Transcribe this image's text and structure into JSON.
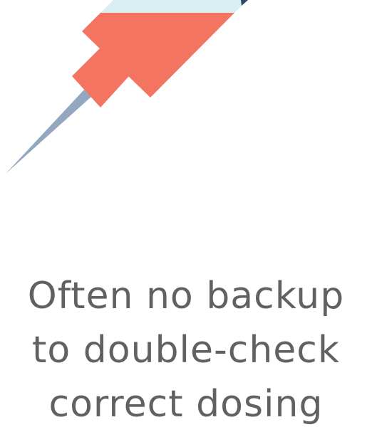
{
  "illustration": {
    "icon": "syringe-icon",
    "colors": {
      "barrel": "#f47462",
      "cap": "#d8eef1",
      "accent": "#2e4a6a",
      "needle": "#93a8c0"
    }
  },
  "caption": {
    "lines": [
      "Often no backup",
      "to double-check",
      "correct dosing"
    ]
  }
}
